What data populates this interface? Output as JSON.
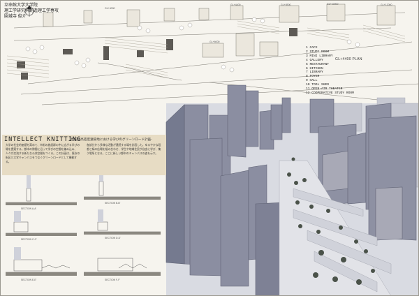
{
  "header": {
    "lines": [
      "立命館大学大学院",
      "理工学研究科創造理工学専攻",
      "圓城寺 俊介"
    ]
  },
  "plan": {
    "title": "GL+4400 PLAN",
    "level_tags": [
      "GL+4000",
      "GL+4400",
      "GL+8500",
      "GL+10000",
      "GL+6000",
      "GL+12000"
    ]
  },
  "legend": {
    "items": [
      "1   CAFE",
      "2   STUDY ROOM",
      "3   MINI LIBRARY",
      "4   GALLERY",
      "5   RESTAURANT",
      "6   KITCHEN",
      "7   LIBRARY",
      "8   FOYER",
      "9   HALL",
      "10  TOOL SHED",
      "11  OPEN-AIR THEATER",
      "12  COOPERATIVE STUDY ROOM"
    ]
  },
  "concept": {
    "title": "INTELLECT KNITTING",
    "subtitle": "-世紀の高密度遠隔地における学びのグリーンロード計画-",
    "body_left": "大学の社会的価値を高めて、市街の施設群の中に広がる学びの場を提案する。都市の隙間に沿って学びの空間を編み込み、人々が交流する新たな公共空間をつくる。この計画は、既存の街区と大学キャンパスをつなぐグリーンロードとして機能する。",
    "body_right": "各部分から多様な活動が連続する場を計画した。ゆるやかな段差と緑の広場を組み合わせ、学生や地域住民が自由に学び、集う場所となる。ここに新しい都市のキャンパスの姿を示す。"
  },
  "sections": {
    "labels": [
      "SECTION A-A'",
      "SECTION B-B'",
      "SECTION C-C'",
      "SECTION D-D'",
      "SECTION E-E'",
      "SECTION F-F'"
    ]
  }
}
